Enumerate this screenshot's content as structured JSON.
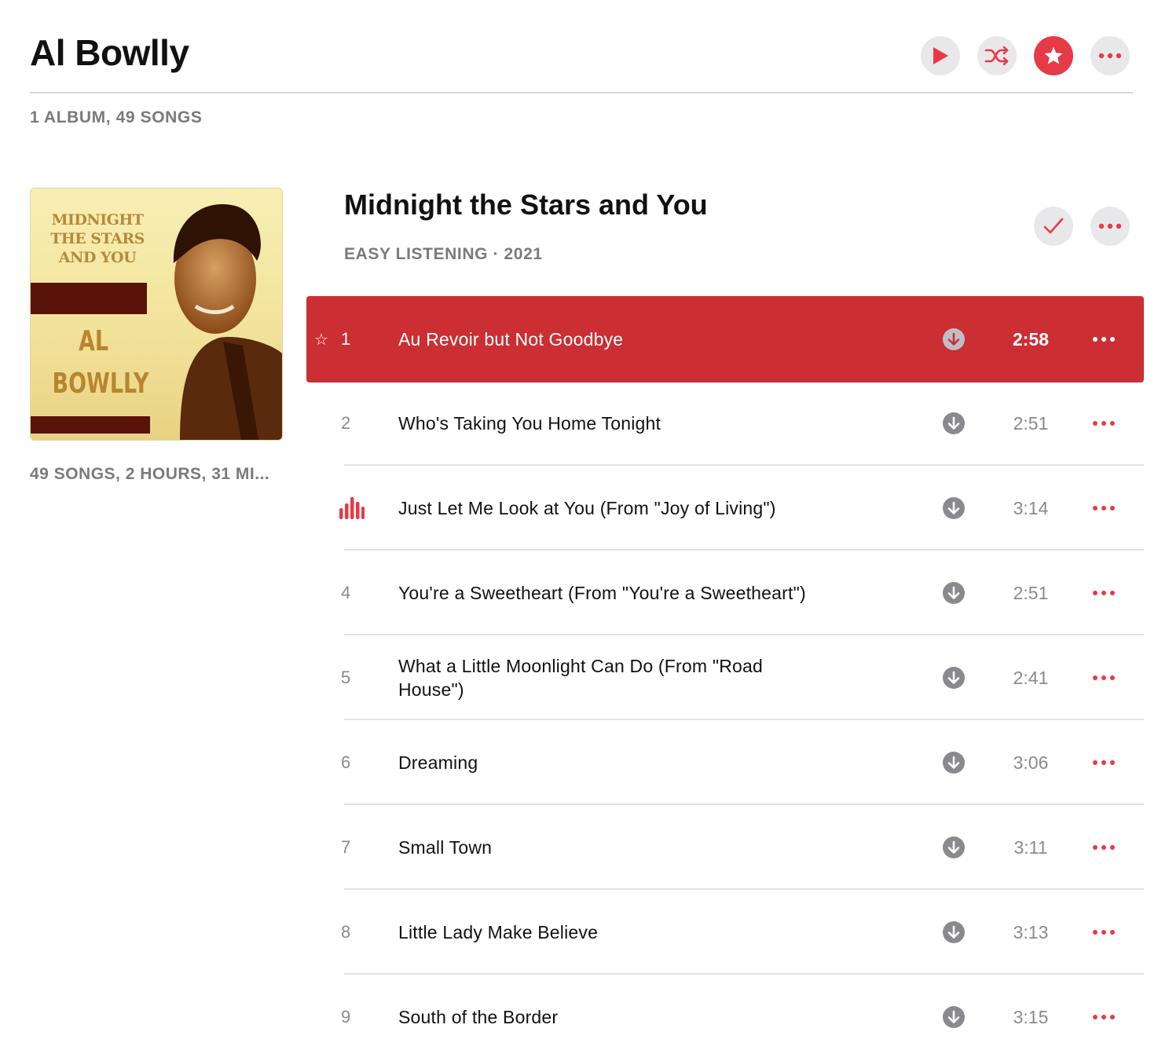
{
  "artist": {
    "name": "Al Bowlly",
    "summary": "1 ALBUM, 49 SONGS"
  },
  "header_actions": [
    "play-icon",
    "shuffle-icon",
    "star-icon",
    "more-icon"
  ],
  "album": {
    "title": "Midnight the Stars and You",
    "genre_year": "EASY LISTENING · 2021",
    "meta": "49 SONGS, 2 HOURS, 31 MI...",
    "art": {
      "top_text": "MIDNIGHT THE STARS AND YOU",
      "artist_text": "AL BOWLLY"
    }
  },
  "colors": {
    "accent": "#e63a46",
    "active_row": "#cb2e33",
    "secondary_text": "#7a7a7e"
  },
  "tracks": [
    {
      "num": "1",
      "title": "Au Revoir but Not Goodbye",
      "duration": "2:58",
      "active": true,
      "starred": true
    },
    {
      "num": "2",
      "title": "Who's Taking You Home Tonight",
      "duration": "2:51"
    },
    {
      "num": "3",
      "title": "Just Let Me Look at You (From \"Joy of Living\")",
      "duration": "3:14",
      "now_playing": true
    },
    {
      "num": "4",
      "title": "You're a Sweetheart (From \"You're a Sweetheart\")",
      "duration": "2:51"
    },
    {
      "num": "5",
      "title": "What a Little Moonlight Can Do (From \"Road House\")",
      "duration": "2:41"
    },
    {
      "num": "6",
      "title": "Dreaming",
      "duration": "3:06"
    },
    {
      "num": "7",
      "title": "Small Town",
      "duration": "3:11"
    },
    {
      "num": "8",
      "title": "Little Lady Make Believe",
      "duration": "3:13"
    },
    {
      "num": "9",
      "title": "South of the Border",
      "duration": "3:15"
    }
  ]
}
